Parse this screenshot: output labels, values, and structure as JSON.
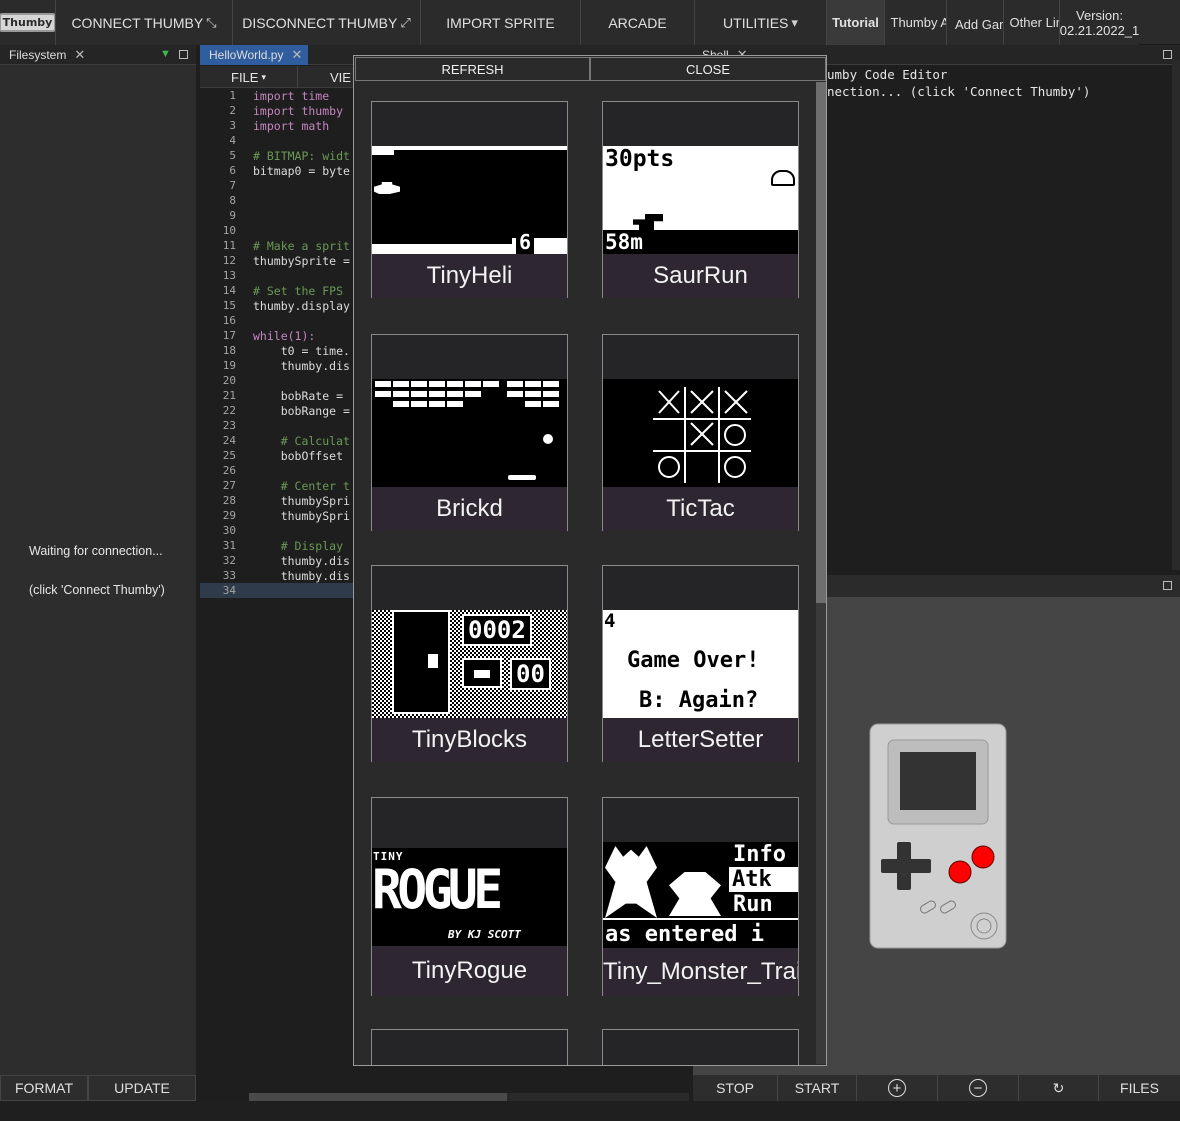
{
  "nav": {
    "logo": "Thumby",
    "connect": "CONNECT THUMBY",
    "disconnect": "DISCONNECT THUMBY",
    "import_sprite": "IMPORT SPRITE",
    "arcade": "ARCADE",
    "utilities": "UTILITIES",
    "tutorial": "Tutorial",
    "thumby_api": "Thumby API",
    "add_game": "Add Game To",
    "other_links": "Other Links",
    "version_label": "Version:",
    "version": "02.21.2022_1"
  },
  "filesystem": {
    "tab": "Filesystem",
    "waiting": "Waiting for connection...",
    "hint": "(click 'Connect Thumby')",
    "format": "FORMAT",
    "update": "UPDATE"
  },
  "editor": {
    "tab": "HelloWorld.py",
    "file_menu": "FILE",
    "view_menu": "VIE",
    "lines": [
      "import time",
      "import thumby",
      "import math",
      "",
      "# BITMAP: widt",
      "bitmap0 = byte",
      "",
      "",
      "",
      "",
      "# Make a sprit",
      "thumbySprite =",
      "",
      "# Set the FPS",
      "thumby.display",
      "",
      "while(1):",
      "    t0 = time.",
      "    thumby.dis",
      "",
      "    bobRate =",
      "    bobRange =",
      "",
      "    # Calculat",
      "    bobOffset",
      "",
      "    # Center t",
      "    thumbySpri",
      "    thumbySpri",
      "",
      "    # Display",
      "    thumby.dis",
      "    thumby.dis",
      ""
    ]
  },
  "shell": {
    "tab": "Shell",
    "line1": "umby Code Editor",
    "line2": "nection... (click 'Connect Thumby')"
  },
  "arcade": {
    "refresh": "REFRESH",
    "close": "CLOSE",
    "games": [
      {
        "name": "TinyHeli"
      },
      {
        "name": "SaurRun",
        "screen_text": [
          "30pts",
          "58m"
        ]
      },
      {
        "name": "Brickd"
      },
      {
        "name": "TicTac"
      },
      {
        "name": "TinyBlocks",
        "screen_text": [
          "0002",
          "00"
        ]
      },
      {
        "name": "LetterSetter",
        "screen_text": [
          "4",
          "Game Over!",
          "B: Again?"
        ]
      },
      {
        "name": "TinyRogue",
        "screen_text": [
          "TINY",
          "ROGUE",
          "BY KJ SCOTT"
        ]
      },
      {
        "name": "Tiny_Monster_Train",
        "screen_text": [
          "Info",
          "Atk",
          "Run",
          "as entered i"
        ]
      }
    ],
    "heli_score": "6"
  },
  "controls": {
    "stop": "STOP",
    "start": "START",
    "zoom_in": "+",
    "zoom_out": "−",
    "rotate": "↻",
    "files": "FILES"
  },
  "colors": {
    "device_body": "#cfcfcf",
    "button_red": "#ff0000",
    "label_bg": "#2e2630"
  }
}
